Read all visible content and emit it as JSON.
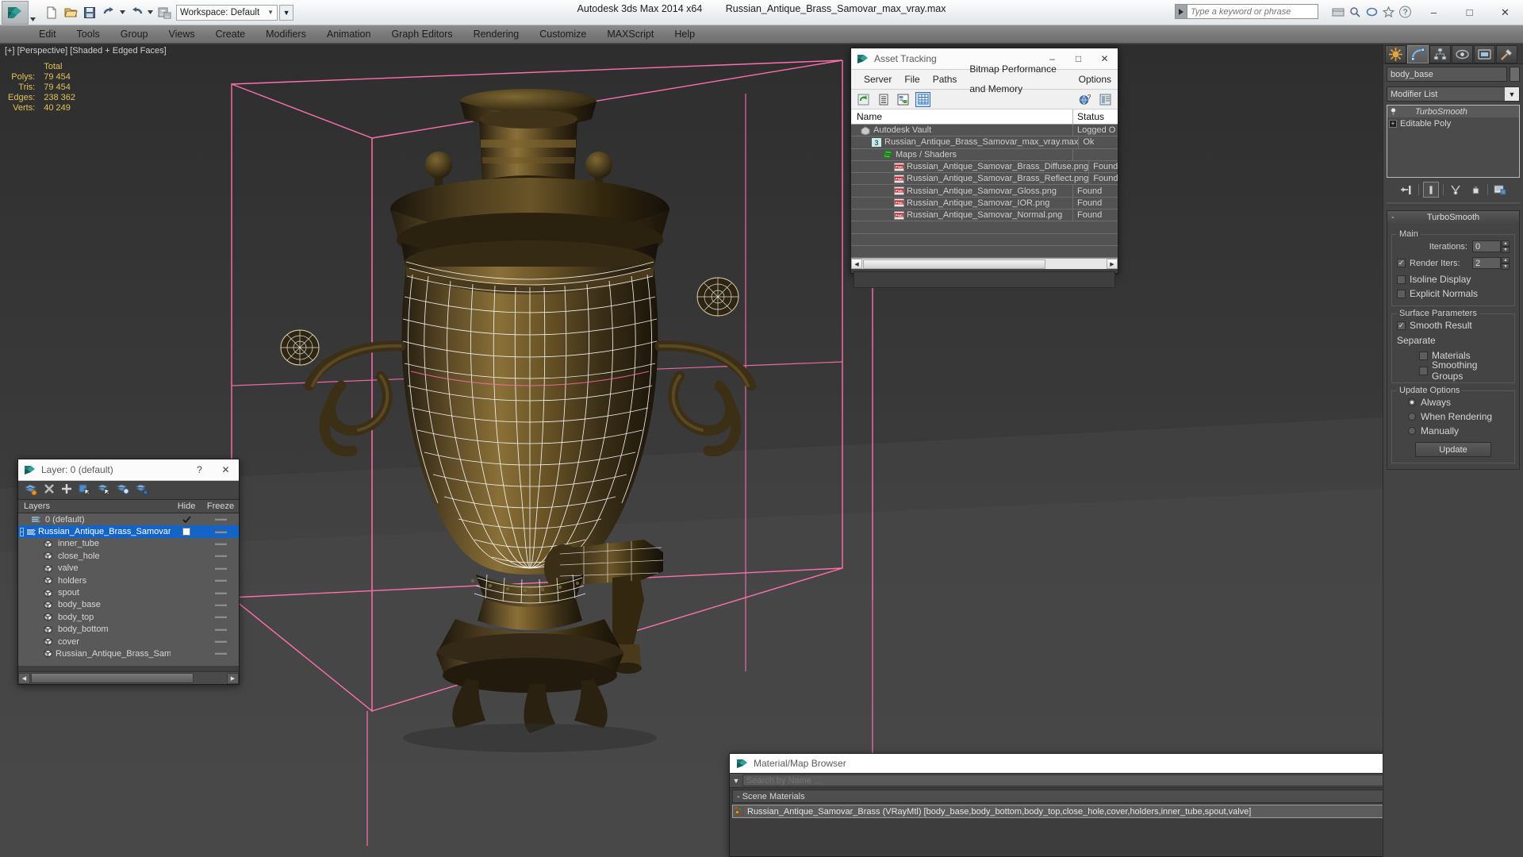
{
  "app": {
    "title": "Autodesk 3ds Max  2014 x64",
    "filename": "Russian_Antique_Brass_Samovar_max_vray.max",
    "workspace_label": "Workspace: Default",
    "search_placeholder": "Type a keyword or phrase"
  },
  "menubar": {
    "items": [
      "Edit",
      "Tools",
      "Group",
      "Views",
      "Create",
      "Modifiers",
      "Animation",
      "Graph Editors",
      "Rendering",
      "Customize",
      "MAXScript",
      "Help"
    ]
  },
  "viewport": {
    "label": "[+] [Perspective] [Shaded + Edged Faces]",
    "stats": {
      "header": "Total",
      "rows": [
        {
          "label": "Polys:",
          "value": "79 454"
        },
        {
          "label": "Tris:",
          "value": "79 454"
        },
        {
          "label": "Edges:",
          "value": "238 362"
        },
        {
          "label": "Verts:",
          "value": "40 249"
        }
      ]
    }
  },
  "asset_tracking": {
    "title": "Asset Tracking",
    "menu": [
      "Server",
      "File",
      "Paths",
      "Bitmap Performance and Memory",
      "Options"
    ],
    "columns": {
      "name": "Name",
      "status": "Status"
    },
    "rows": [
      {
        "name": "Autodesk Vault",
        "status": "Logged O",
        "icon": "vault-icon",
        "indent": 0
      },
      {
        "name": "Russian_Antique_Brass_Samovar_max_vray.max",
        "status": "Ok",
        "icon": "max-file-icon",
        "indent": 1
      },
      {
        "name": "Maps / Shaders",
        "status": "",
        "icon": "maps-icon",
        "indent": 2
      },
      {
        "name": "Russian_Antique_Samovar_Brass_Diffuse.png",
        "status": "Found",
        "icon": "png-icon",
        "indent": 3
      },
      {
        "name": "Russian_Antique_Samovar_Brass_Reflect.png",
        "status": "Found",
        "icon": "png-icon",
        "indent": 3
      },
      {
        "name": "Russian_Antique_Samovar_Gloss.png",
        "status": "Found",
        "icon": "png-icon",
        "indent": 3
      },
      {
        "name": "Russian_Antique_Samovar_IOR.png",
        "status": "Found",
        "icon": "png-icon",
        "indent": 3
      },
      {
        "name": "Russian_Antique_Samovar_Normal.png",
        "status": "Found",
        "icon": "png-icon",
        "indent": 3
      }
    ]
  },
  "layer_explorer": {
    "title": "Layer: 0 (default)",
    "columns": {
      "layers": "Layers",
      "hide": "Hide",
      "freeze": "Freeze"
    },
    "rows": [
      {
        "name": "0 (default)",
        "type": "layer",
        "indent": 0,
        "selected": false,
        "checked": true,
        "expander": ""
      },
      {
        "name": "Russian_Antique_Brass_Samovar",
        "type": "layer",
        "indent": 0,
        "selected": true,
        "checked": false,
        "expander": "-"
      },
      {
        "name": "inner_tube",
        "type": "object",
        "indent": 1,
        "selected": false,
        "checked": false,
        "expander": ""
      },
      {
        "name": "close_hole",
        "type": "object",
        "indent": 1,
        "selected": false,
        "checked": false,
        "expander": ""
      },
      {
        "name": "valve",
        "type": "object",
        "indent": 1,
        "selected": false,
        "checked": false,
        "expander": ""
      },
      {
        "name": "holders",
        "type": "object",
        "indent": 1,
        "selected": false,
        "checked": false,
        "expander": ""
      },
      {
        "name": "spout",
        "type": "object",
        "indent": 1,
        "selected": false,
        "checked": false,
        "expander": ""
      },
      {
        "name": "body_base",
        "type": "object",
        "indent": 1,
        "selected": false,
        "checked": false,
        "expander": ""
      },
      {
        "name": "body_top",
        "type": "object",
        "indent": 1,
        "selected": false,
        "checked": false,
        "expander": ""
      },
      {
        "name": "body_bottom",
        "type": "object",
        "indent": 1,
        "selected": false,
        "checked": false,
        "expander": ""
      },
      {
        "name": "cover",
        "type": "object",
        "indent": 1,
        "selected": false,
        "checked": false,
        "expander": ""
      },
      {
        "name": "Russian_Antique_Brass_Samovar",
        "type": "object",
        "indent": 1,
        "selected": false,
        "checked": false,
        "expander": ""
      }
    ]
  },
  "material_browser": {
    "title": "Material/Map Browser",
    "search_placeholder": "Search by Name ...",
    "group_label": "- Scene Materials",
    "material": "Russian_Antique_Samovar_Brass (VRayMtl) [body_base,body_bottom,body_top,close_hole,cover,holders,inner_tube,spout,valve]"
  },
  "command_panel": {
    "object_name": "body_base",
    "modifier_list_label": "Modifier List",
    "stack": [
      {
        "label": "TurboSmooth",
        "active": true
      },
      {
        "label": "Editable Poly",
        "active": false
      }
    ],
    "rollout": {
      "title": "TurboSmooth",
      "minus": "-",
      "main_group": "Main",
      "iterations_label": "Iterations:",
      "iterations_value": "0",
      "render_iters_label": "Render Iters:",
      "render_iters_value": "2",
      "render_iters_checked": true,
      "isoline_display": "Isoline Display",
      "isoline_checked": false,
      "explicit_normals": "Explicit Normals",
      "explicit_checked": false,
      "surface_group": "Surface Parameters",
      "smooth_result": "Smooth Result",
      "smooth_result_checked": true,
      "separate_label": "Separate",
      "materials": "Materials",
      "materials_checked": false,
      "smoothing_groups": "Smoothing Groups",
      "smoothing_groups_checked": false,
      "update_group": "Update Options",
      "update_options": [
        "Always",
        "When Rendering",
        "Manually"
      ],
      "update_selected": "Always",
      "update_button": "Update"
    }
  },
  "colors": {
    "selection_blue": "#1464c8",
    "accent_pink": "#ff6fae",
    "stat_yellow": "#e2c25a",
    "viewport_bg": "#3f3f3f",
    "material_red": "#c8102e"
  }
}
